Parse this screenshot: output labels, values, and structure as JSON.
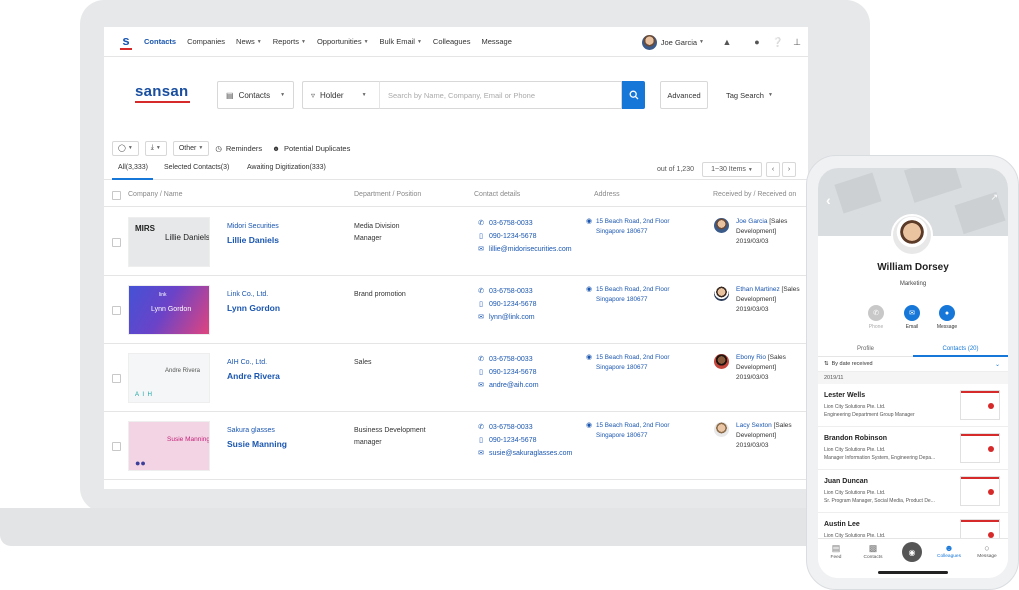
{
  "topnav": {
    "logo": "s",
    "items": [
      "Contacts",
      "Companies",
      "News",
      "Reports",
      "Opportunities",
      "Bulk Email",
      "Colleagues",
      "Message"
    ],
    "user": "Joe Garcia"
  },
  "brand": "sansan",
  "search": {
    "scope": "Contacts",
    "field": "Holder",
    "placeholder": "Search by Name, Company, Email or Phone",
    "advanced": "Advanced",
    "tag_search": "Tag Search"
  },
  "toolbar": {
    "other": "Other",
    "reminders": "Reminders",
    "duplicates": "Potential Duplicates"
  },
  "tabs": [
    "All(3,333)",
    "Selected Contacts(3)",
    "Awaiting Digitization(333)"
  ],
  "pager": {
    "out_of": "out of 1,230",
    "range": "1~30 Items"
  },
  "columns": [
    "Company / Name",
    "Department / Position",
    "Contact details",
    "Address",
    "Received by / Received on"
  ],
  "rows": [
    {
      "company": "Midori Securities",
      "name": "Lillie Daniels",
      "dept": "Media Division",
      "position": "Manager",
      "phone": "03-6758-0033",
      "mobile": "090-1234-5678",
      "email": "lillie@midorisecurities.com",
      "addr1": "15 Beach Road, 2nd Floor",
      "addr2": "Singapore 180677",
      "recv_name": "Joe Garcia",
      "recv_dept1": "[Sales",
      "recv_dept2": "Development]",
      "recv_date": "2019/03/03",
      "card": {
        "logo": "MIRS",
        "name": "Lillie Daniels"
      }
    },
    {
      "company": "Link Co., Ltd.",
      "name": "Lynn Gordon",
      "dept": "Brand promotion",
      "position": "",
      "phone": "03-6758-0033",
      "mobile": "090-1234-5678",
      "email": "lynn@link.com",
      "addr1": "15 Beach Road, 2nd Floor",
      "addr2": "Singapore 180677",
      "recv_name": "Ethan Martinez",
      "recv_dept1": "[Sales",
      "recv_dept2": "Development]",
      "recv_date": "2019/03/03",
      "card": {
        "logo": "link",
        "name": "Lynn Gordon"
      }
    },
    {
      "company": "AIH Co., Ltd.",
      "name": "Andre Rivera",
      "dept": "Sales",
      "position": "",
      "phone": "03-6758-0033",
      "mobile": "090-1234-5678",
      "email": "andre@aih.com",
      "addr1": "15 Beach Road, 2nd Floor",
      "addr2": "Singapore 180677",
      "recv_name": "Ebony Rio",
      "recv_dept1": "[Sales",
      "recv_dept2": "Development]",
      "recv_date": "2019/03/03",
      "card": {
        "logo": "A I H",
        "name": "Andre Rivera"
      }
    },
    {
      "company": "Sakura glasses",
      "name": "Susie Manning",
      "dept": "Business Development",
      "position": "manager",
      "phone": "03-6758-0033",
      "mobile": "090-1234-5678",
      "email": "susie@sakuraglasses.com",
      "addr1": "15 Beach Road, 2nd Floor",
      "addr2": "Singapore 180677",
      "recv_name": "Lacy Sexton",
      "recv_dept1": "[Sales",
      "recv_dept2": "Development]",
      "recv_date": "2019/03/03",
      "card": {
        "logo": "",
        "name": "Susie Manning"
      }
    }
  ],
  "mobile": {
    "name": "William Dorsey",
    "dept": "Marketing",
    "actions": [
      "Phone",
      "Email",
      "Message"
    ],
    "tabs": [
      "Profile",
      "Contacts (20)"
    ],
    "sort": "By date received",
    "group": "2019/11",
    "contacts": [
      {
        "name": "Lester Wells",
        "company": "Lion City Solutions Pte. Ltd.",
        "title": "Engineering Department Group Manager"
      },
      {
        "name": "Brandon Robinson",
        "company": "Lion City Solutions Pte. Ltd.",
        "title": "Manager Information System, Engineering Depa..."
      },
      {
        "name": "Juan Duncan",
        "company": "Lion City Solutions Pte. Ltd.",
        "title": "Sr. Program Manager, Social Media, Product De..."
      },
      {
        "name": "Austin Lee",
        "company": "Lion City Solutions Pte. Ltd.",
        "title": ""
      }
    ],
    "bottom": [
      "Feed",
      "Contacts",
      "Colleagues",
      "Message"
    ]
  }
}
